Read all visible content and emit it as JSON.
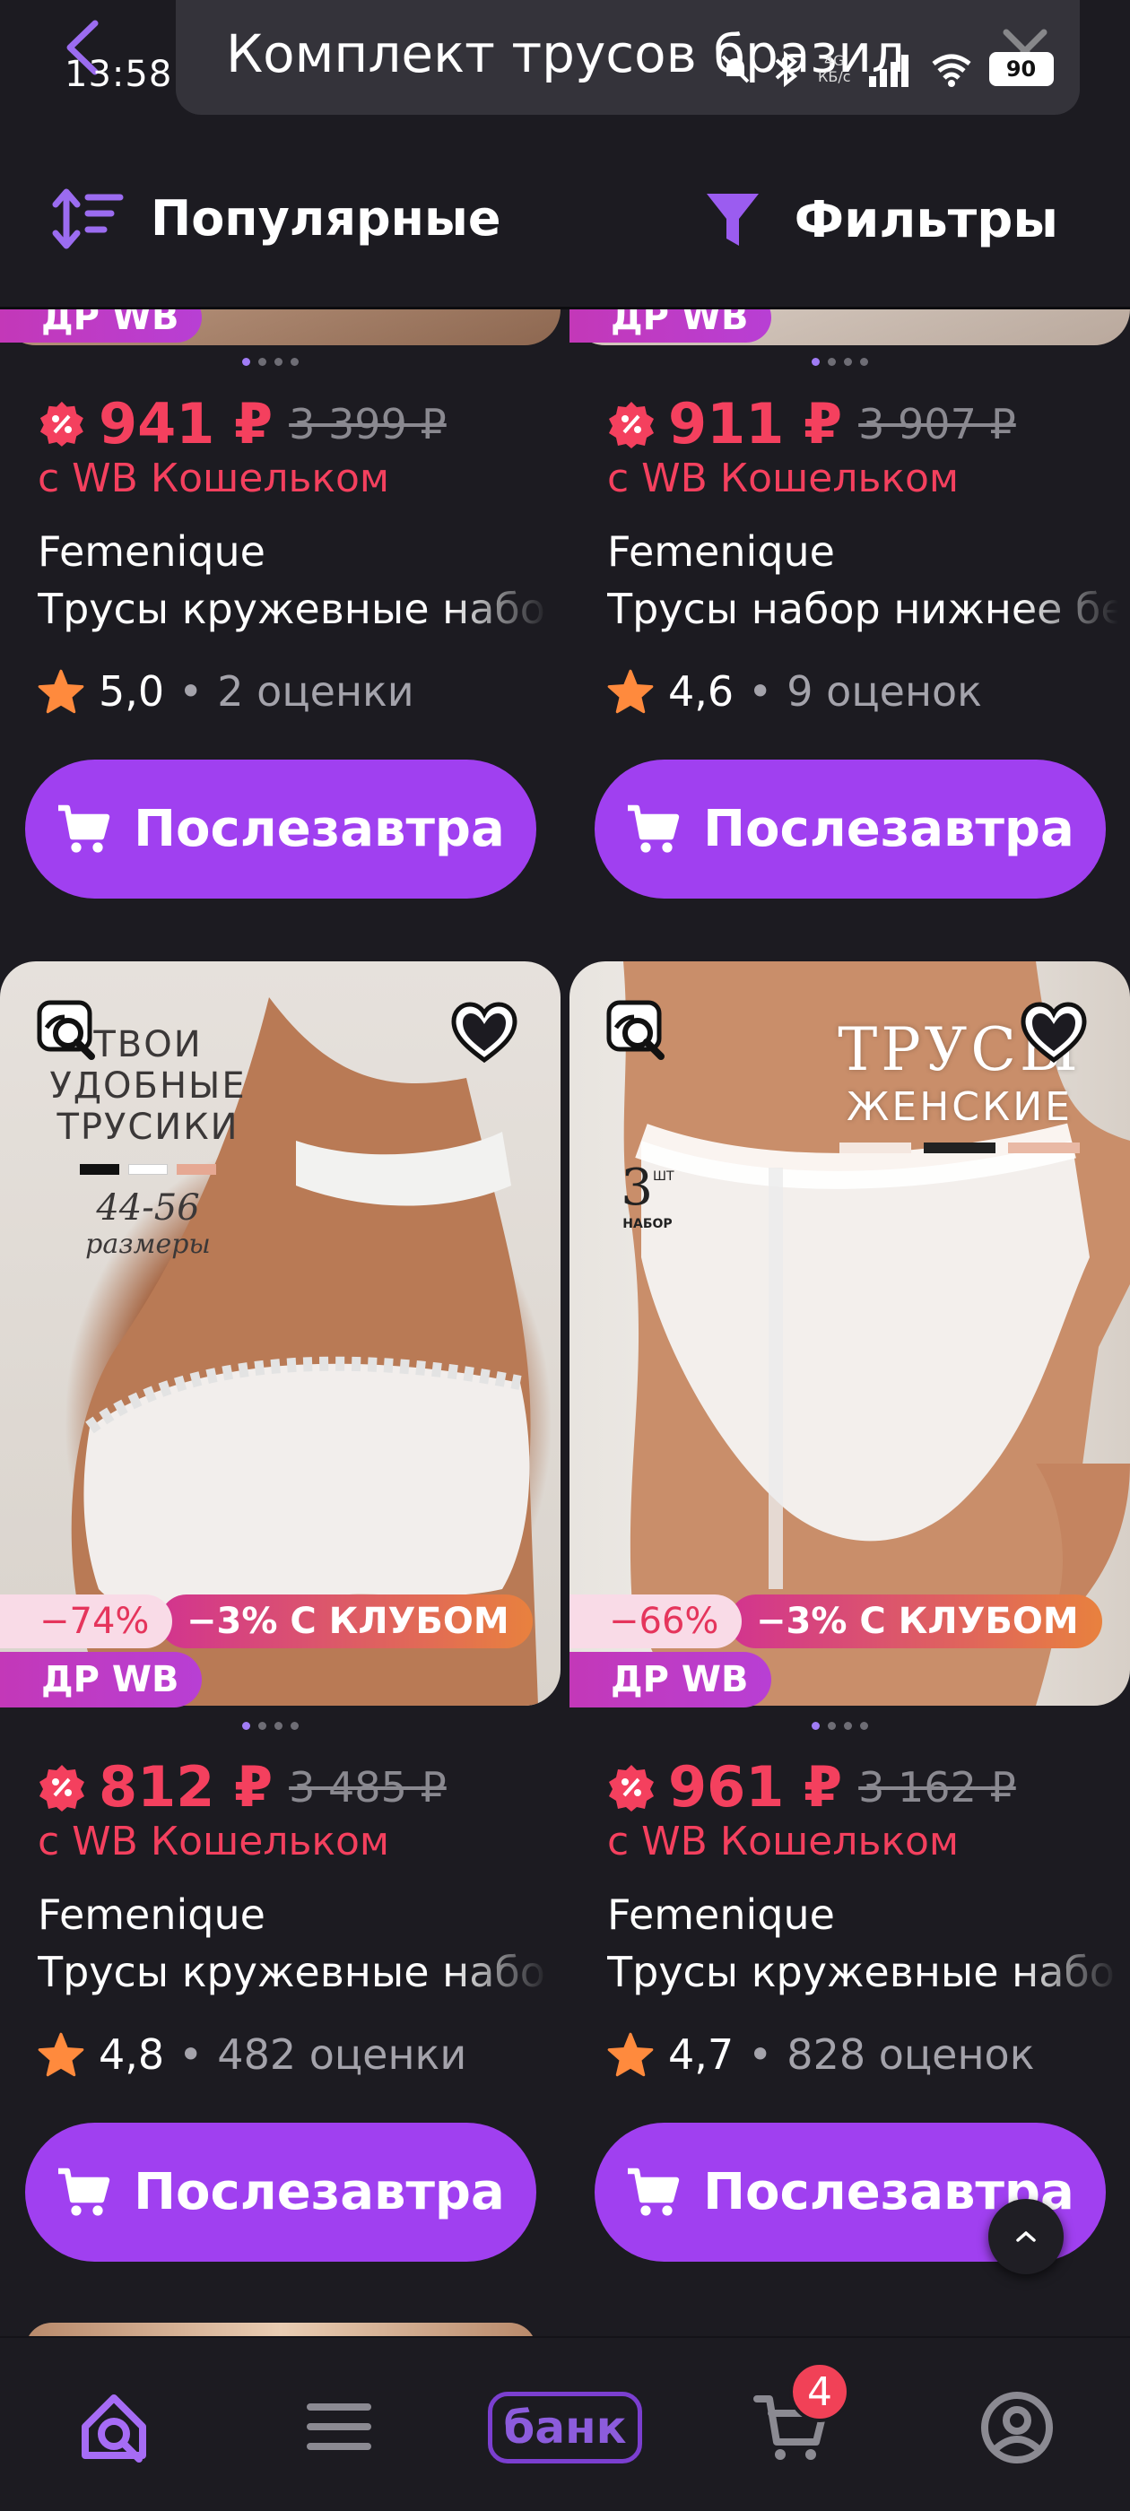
{
  "header": {
    "time": "13:58",
    "search_query": "Комплект трусов бразил",
    "net_speed": "4G\nКБ/с",
    "battery": "90",
    "sort_label": "Популярные",
    "filter_label": "Фильтры"
  },
  "products": [
    {
      "price": "941 ₽",
      "old_price": "3 399 ₽",
      "wallet": "с WB Кошельком",
      "brand": "Femenique",
      "title": "Трусы кружевные набор",
      "rating": "5,0",
      "reviews": "2 оценки",
      "button": "Послезавтра",
      "dr_badge": "ДР WB"
    },
    {
      "price": "911 ₽",
      "old_price": "3 907 ₽",
      "wallet": "с WB Кошельком",
      "brand": "Femenique",
      "title": "Трусы набор нижнее белье",
      "rating": "4,6",
      "reviews": "9 оценок",
      "button": "Послезавтра",
      "dr_badge": "ДР WB"
    },
    {
      "price": "812 ₽",
      "old_price": "3 485 ₽",
      "wallet": "с WB Кошельком",
      "brand": "Femenique",
      "title": "Трусы кружевные набор",
      "rating": "4,8",
      "reviews": "482 оценки",
      "button": "Послезавтра",
      "discount": "−74%",
      "club": "−3% С КЛУБОМ",
      "dr_badge": "ДР WB",
      "image_caption": [
        "ТВОИ",
        "УДОБНЫЕ",
        "ТРУСИКИ",
        "44-56",
        "размеры"
      ]
    },
    {
      "price": "961 ₽",
      "old_price": "3 162 ₽",
      "wallet": "с WB Кошельком",
      "brand": "Femenique",
      "title": "Трусы кружевные набор",
      "rating": "4,7",
      "reviews": "828 оценок",
      "button": "Послезавтра",
      "discount": "−66%",
      "club": "−3% С КЛУБОМ",
      "dr_badge": "ДР WB",
      "image_caption": [
        "ТРУСЫ",
        "ЖЕНСКИЕ",
        "3",
        "ШТ",
        "НАБОР"
      ]
    }
  ],
  "bottom_nav": {
    "bank_label": "банк",
    "cart_count": "4"
  },
  "colors": {
    "accent": "#a040f0",
    "price": "#f4405e",
    "background": "#1c1b21"
  }
}
